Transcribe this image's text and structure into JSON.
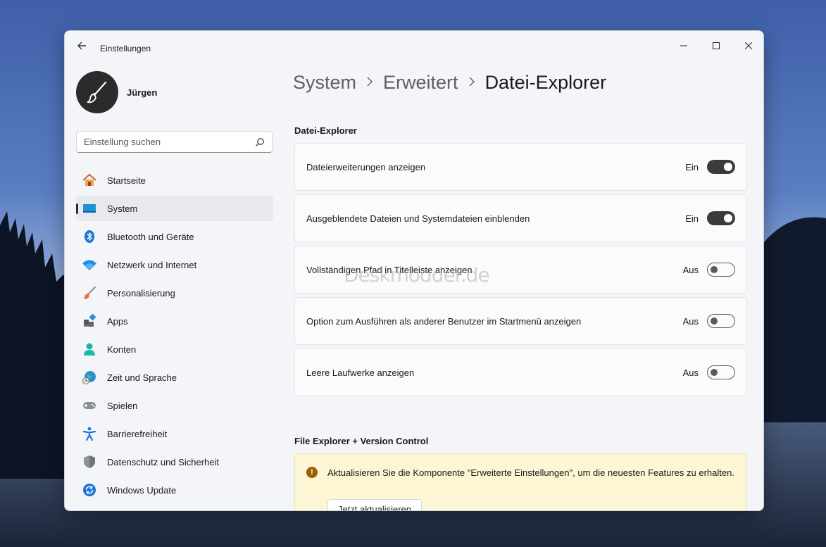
{
  "window": {
    "title": "Einstellungen"
  },
  "profile": {
    "name": "Jürgen"
  },
  "search": {
    "placeholder": "Einstellung suchen"
  },
  "sidebar": {
    "items": [
      {
        "label": "Startseite",
        "icon": "home-icon"
      },
      {
        "label": "System",
        "icon": "system-icon",
        "active": true
      },
      {
        "label": "Bluetooth und Geräte",
        "icon": "bluetooth-icon"
      },
      {
        "label": "Netzwerk und Internet",
        "icon": "wifi-icon"
      },
      {
        "label": "Personalisierung",
        "icon": "brush-icon"
      },
      {
        "label": "Apps",
        "icon": "apps-icon"
      },
      {
        "label": "Konten",
        "icon": "account-icon"
      },
      {
        "label": "Zeit und Sprache",
        "icon": "globe-clock-icon"
      },
      {
        "label": "Spielen",
        "icon": "gamepad-icon"
      },
      {
        "label": "Barrierefreiheit",
        "icon": "accessibility-icon"
      },
      {
        "label": "Datenschutz und Sicherheit",
        "icon": "shield-icon"
      },
      {
        "label": "Windows Update",
        "icon": "update-icon"
      }
    ]
  },
  "breadcrumb": {
    "parts": [
      "System",
      "Erweitert"
    ],
    "current": "Datei-Explorer"
  },
  "section1": {
    "title": "Datei-Explorer",
    "settings": [
      {
        "label": "Dateierweiterungen anzeigen",
        "state": "Ein",
        "on": true
      },
      {
        "label": "Ausgeblendete Dateien und Systemdateien einblenden",
        "state": "Ein",
        "on": true
      },
      {
        "label": "Vollständigen Pfad in Titelleiste anzeigen",
        "state": "Aus",
        "on": false
      },
      {
        "label": "Option zum Ausführen als anderer Benutzer im Startmenü anzeigen",
        "state": "Aus",
        "on": false
      },
      {
        "label": "Leere Laufwerke anzeigen",
        "state": "Aus",
        "on": false
      }
    ]
  },
  "section2": {
    "title": "File Explorer + Version Control",
    "info_text": "Aktualisieren Sie die Komponente \"Erweiterte Einstellungen\", um die neuesten Features zu erhalten.",
    "button_label": "Jetzt aktualisieren"
  },
  "watermark": "Deskmodder.de",
  "colors": {
    "toggle_on": "#3b3b3b",
    "info_bg": "#fdf6d5",
    "info_icon": "#9d5d00"
  }
}
